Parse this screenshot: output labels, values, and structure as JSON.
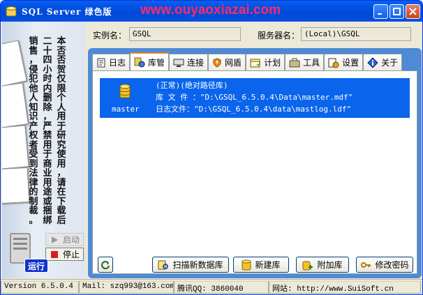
{
  "window": {
    "title": "SQL Server 绿色版",
    "watermark": "www.ouyaoxiazai.com"
  },
  "left_panel": {
    "notice_columns": [
      [
        "本",
        "否",
        "否",
        "贺",
        "仅",
        "限",
        "个",
        "人",
        "用",
        "于",
        "研",
        "究",
        "使",
        "用",
        "，",
        "请",
        "在",
        "下",
        "载",
        "后"
      ],
      [
        "二",
        "十",
        "四",
        "小",
        "时",
        "内",
        "删",
        "除",
        "，",
        "严",
        "禁",
        "用",
        "于",
        "商",
        "业",
        "用",
        "途",
        "或",
        "捆",
        "绑"
      ],
      [
        "销",
        "售",
        "，",
        "侵",
        "犯",
        "他",
        "人",
        "知",
        "识",
        "产",
        "权",
        "者",
        "受",
        "到",
        "法",
        "律",
        "的",
        "制",
        "裁",
        "。"
      ]
    ],
    "start_label": "启动",
    "stop_label": "停止",
    "run_label": "运行"
  },
  "form": {
    "instance_label": "实例名：",
    "instance_value": "GSQL",
    "server_label": "服务器名：",
    "server_value": "(Local)\\GSQL"
  },
  "tabs": [
    {
      "label": "日志",
      "icon": "log-icon"
    },
    {
      "label": "库管",
      "icon": "database-manage-icon",
      "active": true
    },
    {
      "label": "连接",
      "icon": "connection-icon"
    },
    {
      "label": "网盾",
      "icon": "shield-icon"
    },
    {
      "label": "计划",
      "icon": "schedule-icon"
    },
    {
      "label": "工具",
      "icon": "tools-icon"
    },
    {
      "label": "设置",
      "icon": "settings-icon"
    },
    {
      "label": "关于",
      "icon": "about-icon"
    }
  ],
  "database_list": [
    {
      "name": "master",
      "icon": "database-icon",
      "status_line": "(正常)(绝对路径库)",
      "data_file_line": "库 文 件 ：\"D:\\GSQL_6.5.0.4\\Data\\master.mdf\"",
      "log_file_line": "日志文件：\"D:\\GSQL_6.5.0.4\\data\\mastlog.ldf\""
    }
  ],
  "buttons": {
    "refresh": "",
    "scan": "扫描新数据库",
    "new": "新建库",
    "attach": "附加库",
    "password": "修改密码"
  },
  "status_bar": {
    "version": "Version 6.5.0.4",
    "mail": "Mail: szq993@163.com",
    "qq": "腾讯QQ: 3860040",
    "website": "网站: http://www.SuiSoft.cn"
  },
  "colors": {
    "titlebar": "#0054e3",
    "selection": "#0a64ec",
    "tab_border_blue": "#4e8ad6",
    "active_tab_accent": "#e68b2c",
    "watermark": "#ff2a6a"
  }
}
